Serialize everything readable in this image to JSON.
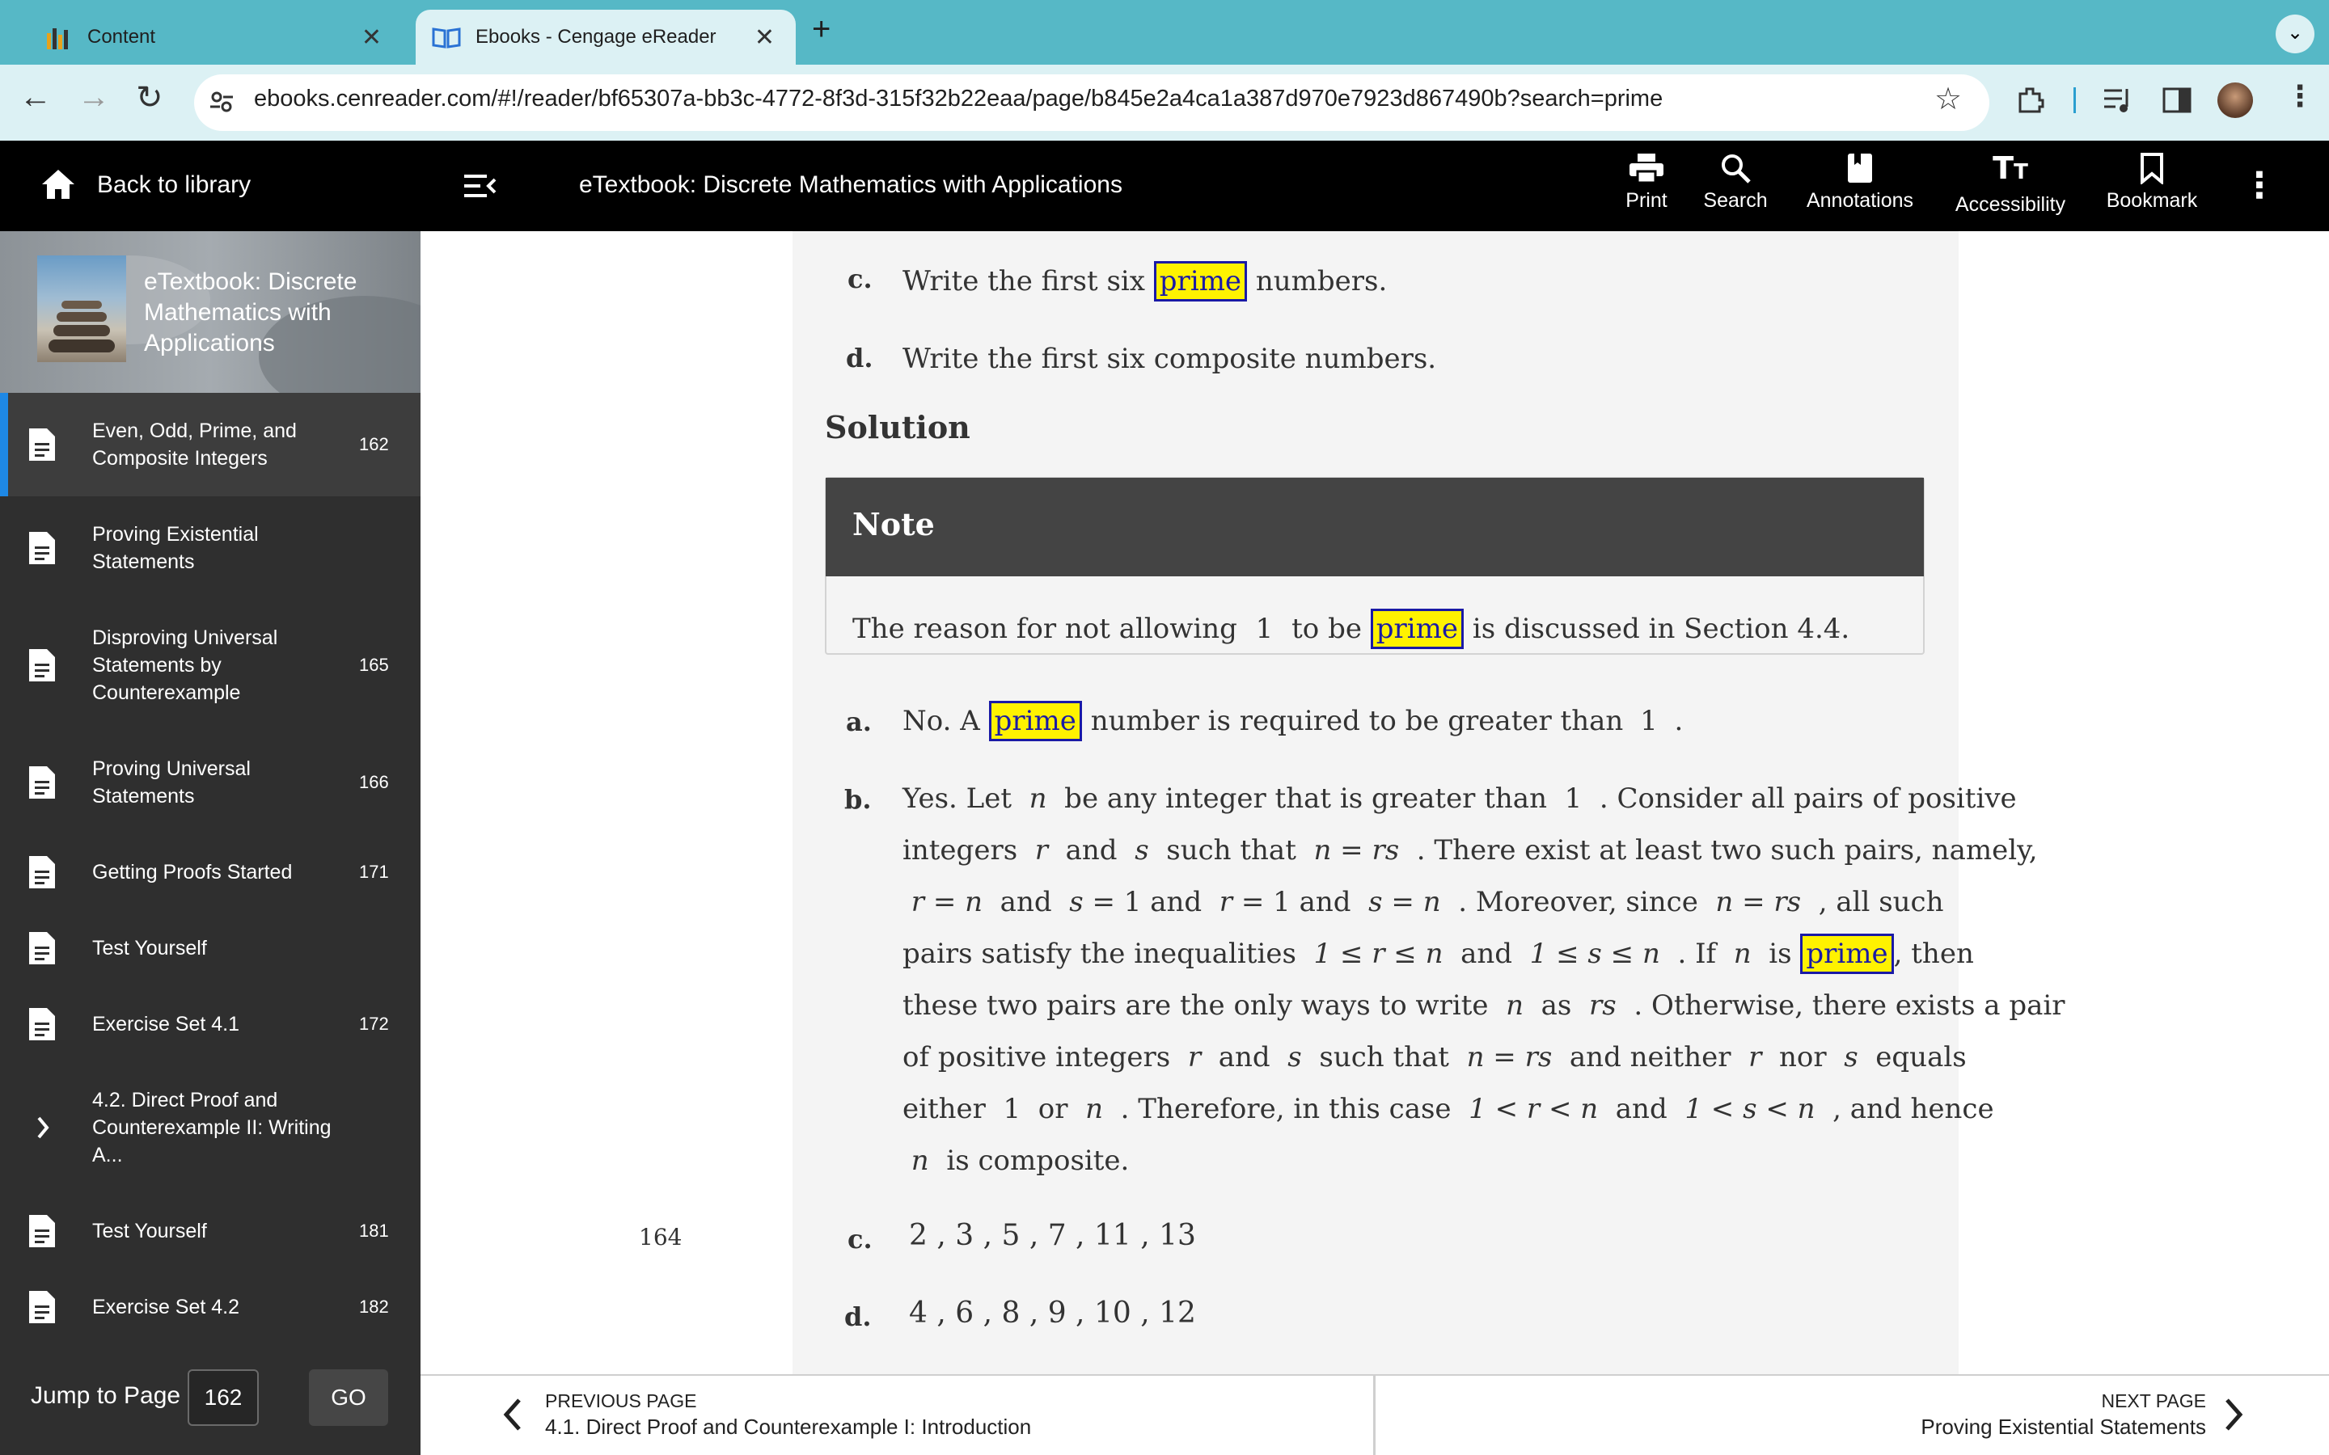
{
  "browser": {
    "tabs": [
      {
        "title": "Content"
      },
      {
        "title": "Ebooks - Cengage eReader"
      }
    ],
    "url": "ebooks.cenreader.com/#!/reader/bf65307a-bb3c-4772-8f3d-315f32b22eaa/page/b845e2a4ca1a387d970e7923d867490b?search=prime"
  },
  "appbar": {
    "back_label": "Back to library",
    "title": "eTextbook: Discrete Mathematics with Applications",
    "actions": [
      "Print",
      "Search",
      "Annotations",
      "Accessibility",
      "Bookmark"
    ]
  },
  "sidebar": {
    "book_title": "eTextbook: Discrete Mathematics with Applications",
    "items": [
      {
        "label": "Even, Odd, Prime, and Composite Integers",
        "page": "162"
      },
      {
        "label": "Proving Existential Statements",
        "page": ""
      },
      {
        "label": "Disproving Universal Statements by Counterexample",
        "page": "165"
      },
      {
        "label": "Proving Universal Statements",
        "page": "166"
      },
      {
        "label": "Getting Proofs Started",
        "page": "171"
      },
      {
        "label": "Test Yourself",
        "page": ""
      },
      {
        "label": "Exercise Set 4.1",
        "page": "172"
      },
      {
        "label": "4.2. Direct Proof and Counterexample II: Writing A...",
        "page": ""
      },
      {
        "label": "Test Yourself",
        "page": "181"
      },
      {
        "label": "Exercise Set 4.2",
        "page": "182"
      }
    ],
    "jump_label": "Jump to Page",
    "jump_value": "162",
    "go_label": "GO"
  },
  "content": {
    "page_number": "164",
    "c_label": "c.",
    "c_text_pre": "Write the first six",
    "c_text_post": "numbers.",
    "d_label": "d.",
    "d_text": "Write the first six composite numbers.",
    "solution_heading": "Solution",
    "note_title": "Note",
    "note_pre": "The reason for not allowing",
    "note_one": "1",
    "note_mid": "to be",
    "note_post": "is discussed in Section 4.4.",
    "search_term": "prime",
    "a_label": "a.",
    "a_pre": "No. A",
    "a_post": "number is required to be greater than",
    "a_one": "1",
    "a_end": ".",
    "b_label": "b.",
    "c2_label": "c.",
    "primes": "2 , 3 , 5 , 7 , 11 , 13",
    "d2_label": "d.",
    "composites": "4 , 6 , 8 , 9 , 10 , 12"
  },
  "footer": {
    "prev_caption": "PREVIOUS PAGE",
    "prev_title": "4.1. Direct Proof and Counterexample I: Introduction",
    "next_caption": "NEXT PAGE",
    "next_title": "Proving Existential Statements"
  }
}
